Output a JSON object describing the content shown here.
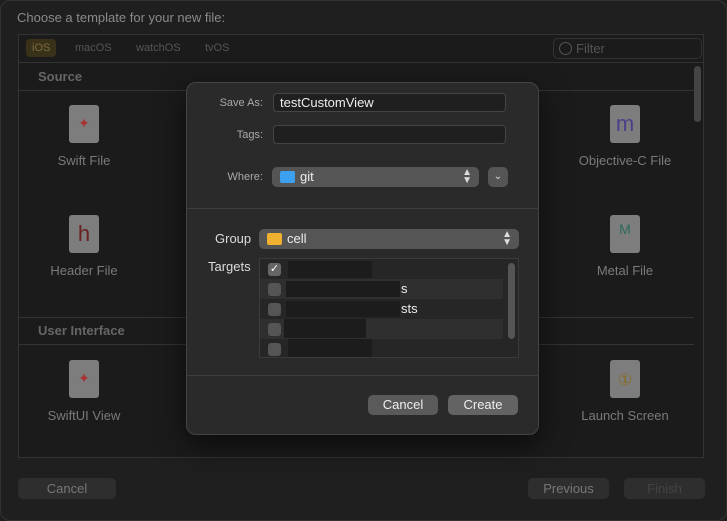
{
  "window": {
    "title": "Choose a template for your new file:"
  },
  "platform_tabs": [
    {
      "label": "iOS",
      "selected": true
    },
    {
      "label": "macOS"
    },
    {
      "label": "watchOS"
    },
    {
      "label": "tvOS"
    }
  ],
  "filter": {
    "placeholder": "Filter"
  },
  "sections": {
    "source": "Source",
    "ui": "User Interface"
  },
  "templates": {
    "swift": {
      "label": "Swift File",
      "icon": "SWIFT"
    },
    "objc": {
      "label": "Objective-C File",
      "icon": "m"
    },
    "header": {
      "label": "Header File",
      "icon": "h"
    },
    "metal": {
      "label": "Metal File",
      "icon": "METAL"
    },
    "swiftui": {
      "label": "SwiftUI View",
      "icon": "SWIFT"
    },
    "launch": {
      "label": "Launch Screen"
    }
  },
  "footer": {
    "cancel": "Cancel",
    "previous": "Previous",
    "finish": "Finish"
  },
  "dialog": {
    "save_as_label": "Save As:",
    "save_as_value": "testCustomView",
    "tags_label": "Tags:",
    "tags_value": "",
    "where_label": "Where:",
    "where_value": "git",
    "group_label": "Group",
    "group_value": "cell",
    "targets_label": "Targets",
    "targets": [
      {
        "name": "",
        "checked": true
      },
      {
        "name": "s",
        "checked": false
      },
      {
        "name": "sts",
        "checked": false
      },
      {
        "name": "",
        "checked": false
      },
      {
        "name": "",
        "checked": false
      }
    ],
    "cancel": "Cancel",
    "create": "Create",
    "accent": "#2f7cf6"
  }
}
